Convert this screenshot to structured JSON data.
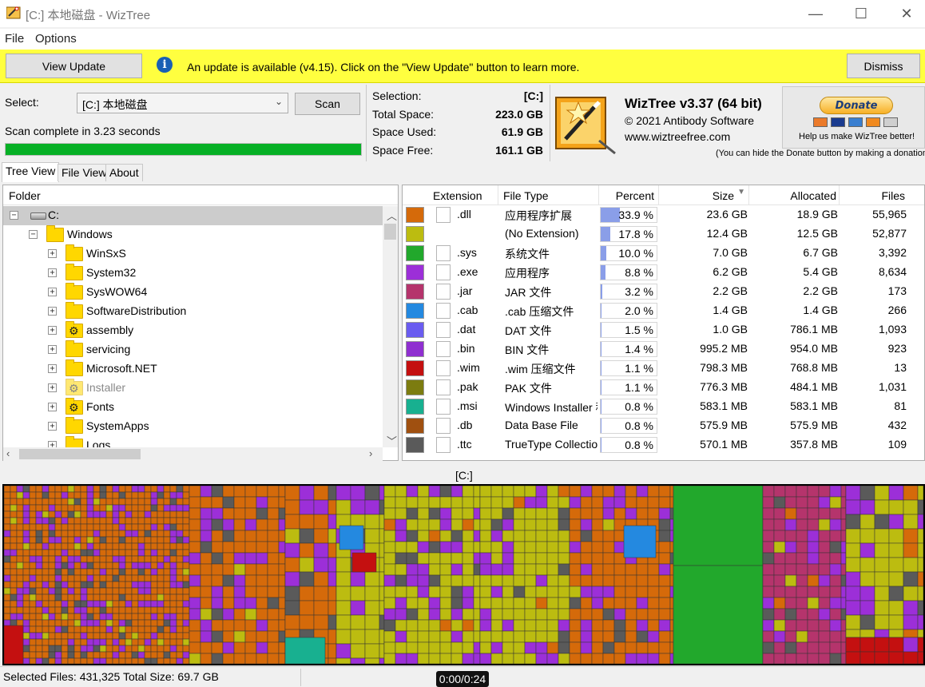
{
  "window": {
    "title": "[C:] 本地磁盘  - WizTree",
    "minimize_glyph": "—",
    "maximize_glyph": "☐",
    "close_glyph": "✕"
  },
  "menu": {
    "items": [
      "File",
      "Options"
    ]
  },
  "update_bar": {
    "view_update_label": "View Update",
    "message": "An update is available (v4.15). Click on the \"View Update\" button to learn more.",
    "dismiss_label": "Dismiss"
  },
  "scan": {
    "select_label": "Select:",
    "drive_value": "[C:] 本地磁盘",
    "scan_label": "Scan",
    "status": "Scan complete in 3.23 seconds",
    "progress": 1.0
  },
  "stats": {
    "selection_label": "Selection:",
    "selection_value": "[C:]",
    "total_label": "Total Space:",
    "total_value": "223.0 GB",
    "used_label": "Space Used:",
    "used_value": "61.9 GB",
    "free_label": "Space Free:",
    "free_value": "161.1 GB"
  },
  "about": {
    "product": "WizTree v3.37 (64 bit)",
    "copyright": "© 2021 Antibody Software",
    "website": "www.wiztreefree.com",
    "donate_label": "Donate",
    "donate_help": "Help us make WizTree better!",
    "donate_hint": "(You can hide the Donate button by making a donation"
  },
  "tabs": [
    "Tree View",
    "File View",
    "About"
  ],
  "tree": {
    "header": "Folder",
    "rows": [
      {
        "label": "C:",
        "level": 0,
        "kind": "drive",
        "selected": true
      },
      {
        "label": "Windows",
        "level": 1,
        "kind": "folder"
      },
      {
        "label": "WinSxS",
        "level": 2,
        "kind": "folder"
      },
      {
        "label": "System32",
        "level": 2,
        "kind": "folder"
      },
      {
        "label": "SysWOW64",
        "level": 2,
        "kind": "folder"
      },
      {
        "label": "SoftwareDistribution",
        "level": 2,
        "kind": "folder"
      },
      {
        "label": "assembly",
        "level": 2,
        "kind": "gear"
      },
      {
        "label": "servicing",
        "level": 2,
        "kind": "folder"
      },
      {
        "label": "Microsoft.NET",
        "level": 2,
        "kind": "folder"
      },
      {
        "label": "Installer",
        "level": 2,
        "kind": "gear-dim"
      },
      {
        "label": "Fonts",
        "level": 2,
        "kind": "gear"
      },
      {
        "label": "SystemApps",
        "level": 2,
        "kind": "folder"
      },
      {
        "label": "Logs",
        "level": 2,
        "kind": "folder"
      }
    ]
  },
  "extensions": {
    "columns": [
      "Extension",
      "File Type",
      "Percent",
      "Size",
      "Allocated",
      "Files"
    ],
    "rows": [
      {
        "color": "#d56a0a",
        "ext": ".dll",
        "type": "应用程序扩展",
        "percent": "33.9 %",
        "pct": 33.9,
        "size": "23.6 GB",
        "allocated": "18.9 GB",
        "files": "55,965"
      },
      {
        "color": "#bcbc10",
        "ext": "",
        "type": "(No Extension)",
        "percent": "17.8 %",
        "pct": 17.8,
        "size": "12.4 GB",
        "allocated": "12.5 GB",
        "files": "52,877"
      },
      {
        "color": "#22a82c",
        "ext": ".sys",
        "type": "系统文件",
        "percent": "10.0 %",
        "pct": 10.0,
        "size": "7.0 GB",
        "allocated": "6.7 GB",
        "files": "3,392"
      },
      {
        "color": "#9c2fd8",
        "ext": ".exe",
        "type": "应用程序",
        "percent": "8.8 %",
        "pct": 8.8,
        "size": "6.2 GB",
        "allocated": "5.4 GB",
        "files": "8,634"
      },
      {
        "color": "#b5346c",
        "ext": ".jar",
        "type": "JAR 文件",
        "percent": "3.2 %",
        "pct": 3.2,
        "size": "2.2 GB",
        "allocated": "2.2 GB",
        "files": "173"
      },
      {
        "color": "#2489e0",
        "ext": ".cab",
        "type": ".cab 压缩文件",
        "percent": "2.0 %",
        "pct": 2.0,
        "size": "1.4 GB",
        "allocated": "1.4 GB",
        "files": "266"
      },
      {
        "color": "#6a5cf0",
        "ext": ".dat",
        "type": "DAT 文件",
        "percent": "1.5 %",
        "pct": 1.5,
        "size": "1.0 GB",
        "allocated": "786.1 MB",
        "files": "1,093"
      },
      {
        "color": "#8f2fd0",
        "ext": ".bin",
        "type": "BIN 文件",
        "percent": "1.4 %",
        "pct": 1.4,
        "size": "995.2 MB",
        "allocated": "954.0 MB",
        "files": "923"
      },
      {
        "color": "#c41010",
        "ext": ".wim",
        "type": ".wim 压缩文件",
        "percent": "1.1 %",
        "pct": 1.1,
        "size": "798.3 MB",
        "allocated": "768.8 MB",
        "files": "13"
      },
      {
        "color": "#7c7c10",
        "ext": ".pak",
        "type": "PAK 文件",
        "percent": "1.1 %",
        "pct": 1.1,
        "size": "776.3 MB",
        "allocated": "484.1 MB",
        "files": "1,031"
      },
      {
        "color": "#18b090",
        "ext": ".msi",
        "type": "Windows Installer 程序包",
        "percent": "0.8 %",
        "pct": 0.8,
        "size": "583.1 MB",
        "allocated": "583.1 MB",
        "files": "81"
      },
      {
        "color": "#a05010",
        "ext": ".db",
        "type": "Data Base File",
        "percent": "0.8 %",
        "pct": 0.8,
        "size": "575.9 MB",
        "allocated": "575.9 MB",
        "files": "432"
      },
      {
        "color": "#5a5a5a",
        "ext": ".ttc",
        "type": "TrueType Collection",
        "percent": "0.8 %",
        "pct": 0.8,
        "size": "570.1 MB",
        "allocated": "357.8 MB",
        "files": "109"
      }
    ]
  },
  "treemap": {
    "label": "[C:]"
  },
  "status": {
    "text": "Selected Files: 431,325  Total Size: 69.7 GB",
    "video_time": "0:00/0:24"
  },
  "colors": {
    "update_bar": "#ffff3f",
    "progress": "#06b025",
    "selected_row": "#cccccc"
  }
}
